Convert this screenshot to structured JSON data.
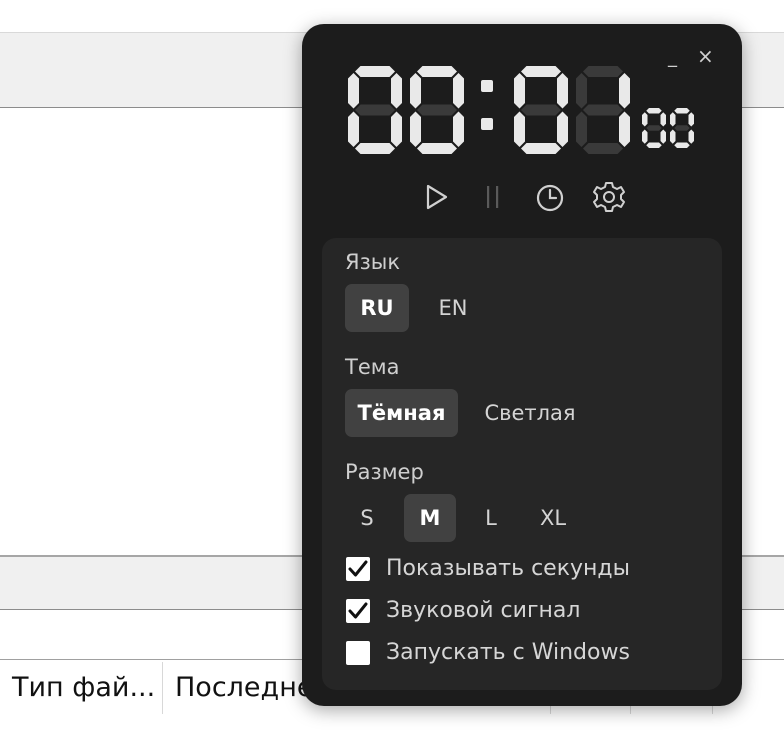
{
  "background": {
    "columns": [
      {
        "label": "Тип фай..."
      },
      {
        "label": "Последне"
      }
    ]
  },
  "window": {
    "minimize_label": "_",
    "close_label": "×"
  },
  "clock": {
    "hours": "00",
    "minutes": "01",
    "seconds": "00",
    "separator": ":"
  },
  "controls": [
    {
      "name": "play",
      "icon": "play-icon",
      "enabled": true
    },
    {
      "name": "pause",
      "icon": "pause-icon",
      "enabled": false
    },
    {
      "name": "history",
      "icon": "clock-icon",
      "enabled": true
    },
    {
      "name": "settings",
      "icon": "gear-icon",
      "enabled": true
    }
  ],
  "settings": {
    "language": {
      "label": "Язык",
      "options": [
        "RU",
        "EN"
      ],
      "selected": "RU"
    },
    "theme": {
      "label": "Тема",
      "options": [
        "Тёмная",
        "Светлая"
      ],
      "selected": "Тёмная"
    },
    "size": {
      "label": "Размер",
      "options": [
        "S",
        "M",
        "L",
        "XL"
      ],
      "selected": "M"
    },
    "checkboxes": [
      {
        "label": "Показывать секунды",
        "checked": true
      },
      {
        "label": "Звуковой сигнал",
        "checked": true
      },
      {
        "label": "Запускать с Windows",
        "checked": false
      }
    ]
  },
  "colors": {
    "widget_bg": "#1c1c1c",
    "panel_bg": "#262626",
    "segment_on": "#e9e9e9",
    "segment_off": "#3a3a3a",
    "active_option": "#414141"
  }
}
